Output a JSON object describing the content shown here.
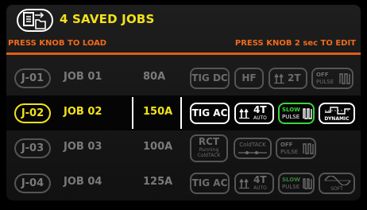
{
  "header": {
    "title": "4 SAVED JOBS",
    "icon": "saved-jobs-icon"
  },
  "hints": {
    "left": "PRESS KNOB TO LOAD",
    "right": "PRESS KNOB 2 sec TO EDIT"
  },
  "colors": {
    "accent_yellow": "#f2e21a",
    "accent_orange": "#e25d12",
    "slow_green": "#3bd63b"
  },
  "jobs": [
    {
      "id": "J-01",
      "name": "JOB 01",
      "amps": "80A",
      "process": "TIG DC",
      "start": "HF",
      "trigger": "2T",
      "pulse_top": "OFF",
      "pulse_bottom": "PULSE",
      "selected": false
    },
    {
      "id": "J-02",
      "name": "JOB 02",
      "amps": "150A",
      "process": "TIG AC",
      "trigger": "4T",
      "trigger_sub": "AUTO",
      "pulse_top": "SLOW",
      "pulse_bottom": "PULSE",
      "wave": "DYNAMIC",
      "selected": true
    },
    {
      "id": "J-03",
      "name": "JOB 03",
      "amps": "100A",
      "process": "RCT",
      "process_sub1": "Running",
      "process_sub2": "ColdTACK",
      "mode": "ColdTACK",
      "pulse_top": "OFF",
      "pulse_bottom": "PULSE",
      "selected": false
    },
    {
      "id": "J-04",
      "name": "JOB 04",
      "amps": "125A",
      "process": "TIG AC",
      "trigger": "4T",
      "trigger_sub": "AUTO",
      "pulse_top": "SLOW",
      "pulse_bottom": "PULSE",
      "wave": "SOFT",
      "selected": false
    }
  ]
}
